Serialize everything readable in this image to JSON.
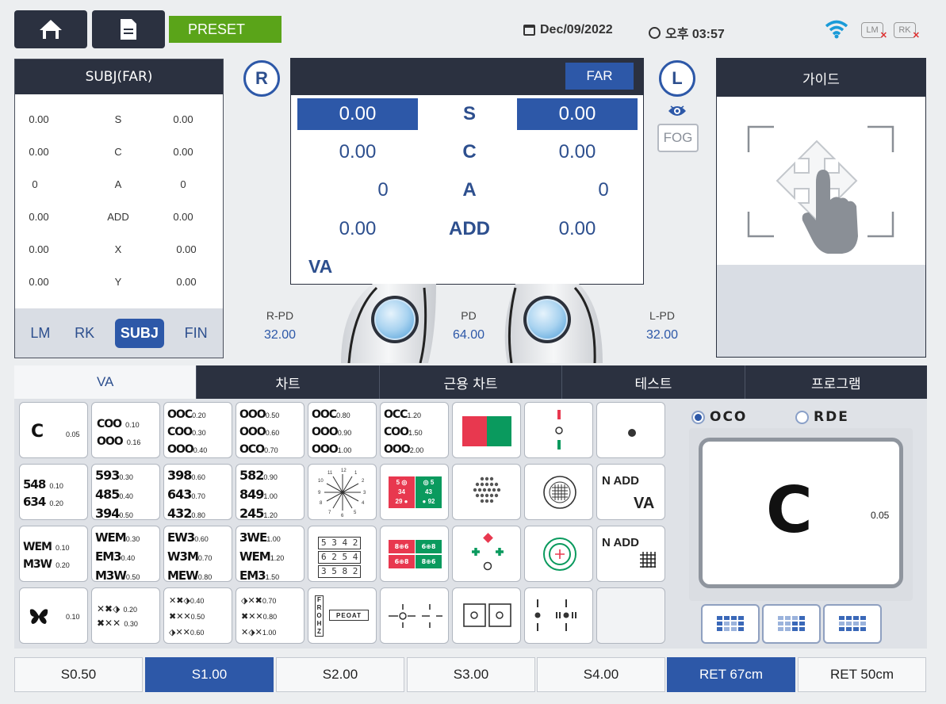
{
  "topbar": {
    "preset_label": "PRESET",
    "date": "Dec/09/2022",
    "time": "오후 03:57",
    "lm_badge": "LM",
    "rk_badge": "RK"
  },
  "subj_panel": {
    "title": "SUBJ(FAR)",
    "rows": [
      {
        "r": "0.00",
        "label": "S",
        "l": "0.00"
      },
      {
        "r": "0.00",
        "label": "C",
        "l": "0.00"
      },
      {
        "r": "0",
        "label": "A",
        "l": "0"
      },
      {
        "r": "0.00",
        "label": "ADD",
        "l": "0.00"
      },
      {
        "r": "0.00",
        "label": "X",
        "l": "0.00"
      },
      {
        "r": "0.00",
        "label": "Y",
        "l": "0.00"
      }
    ],
    "tabs": [
      "LM",
      "RK",
      "SUBJ",
      "FIN"
    ],
    "active_tab": "SUBJ"
  },
  "center": {
    "r_label": "R",
    "l_label": "L",
    "far_label": "FAR",
    "fog_label": "FOG",
    "rows": [
      {
        "r": "0.00",
        "label": "S",
        "l": "0.00",
        "highlight": true
      },
      {
        "r": "0.00",
        "label": "C",
        "l": "0.00",
        "highlight": false
      },
      {
        "r": "0",
        "label": "A",
        "l": "0",
        "highlight": false
      },
      {
        "r": "0.00",
        "label": "ADD",
        "l": "0.00",
        "highlight": false
      }
    ],
    "va_label": "VA"
  },
  "pd": {
    "r_label": "R-PD",
    "r_value": "32.00",
    "c_label": "PD",
    "c_value": "64.00",
    "l_label": "L-PD",
    "l_value": "32.00"
  },
  "guide": {
    "title": "가이드"
  },
  "tabs": [
    "VA",
    "차트",
    "근용 차트",
    "테스트",
    "프로그램"
  ],
  "active_tab": "VA",
  "charts": {
    "c1": {
      "sym": "C",
      "sub": "0.05"
    },
    "c2": [
      {
        "sym": "COO",
        "sub": "0.10"
      },
      {
        "sym": "OOO",
        "sub": "0.16"
      }
    ],
    "c3": [
      {
        "sym": "OOC",
        "sub": "0.20"
      },
      {
        "sym": "COO",
        "sub": "0.30"
      },
      {
        "sym": "OOO",
        "sub": "0.40"
      }
    ],
    "c4": [
      {
        "sym": "OOO",
        "sub": "0.50"
      },
      {
        "sym": "OOO",
        "sub": "0.60"
      },
      {
        "sym": "OCO",
        "sub": "0.70"
      }
    ],
    "c5": [
      {
        "sym": "OOC",
        "sub": "0.80"
      },
      {
        "sym": "OOO",
        "sub": "0.90"
      },
      {
        "sym": "OOO",
        "sub": "1.00"
      }
    ],
    "c6": [
      {
        "sym": "OCC",
        "sub": "1.20"
      },
      {
        "sym": "COO",
        "sub": "1.50"
      },
      {
        "sym": "OOO",
        "sub": "2.00"
      }
    ],
    "n1": [
      {
        "sym": "548",
        "sub": "0.10"
      },
      {
        "sym": "634",
        "sub": "0.20"
      }
    ],
    "n2": [
      {
        "sym": "593",
        "sub": "0.30"
      },
      {
        "sym": "485",
        "sub": "0.40"
      },
      {
        "sym": "394",
        "sub": "0.50"
      }
    ],
    "n3": [
      {
        "sym": "398",
        "sub": "0.60"
      },
      {
        "sym": "643",
        "sub": "0.70"
      },
      {
        "sym": "432",
        "sub": "0.80"
      }
    ],
    "n4": [
      {
        "sym": "582",
        "sub": "0.90"
      },
      {
        "sym": "849",
        "sub": "1.00"
      },
      {
        "sym": "245",
        "sub": "1.20"
      }
    ],
    "w1": [
      {
        "sym": "WEM",
        "sub": "0.10"
      },
      {
        "sym": "M3W",
        "sub": "0.20"
      }
    ],
    "w2": [
      {
        "sym": "WEM",
        "sub": "0.30"
      },
      {
        "sym": "EM3",
        "sub": "0.40"
      },
      {
        "sym": "M3W",
        "sub": "0.50"
      }
    ],
    "w3": [
      {
        "sym": "EW3",
        "sub": "0.60"
      },
      {
        "sym": "W3M",
        "sub": "0.70"
      },
      {
        "sym": "MEW",
        "sub": "0.80"
      }
    ],
    "w4": [
      {
        "sym": "3WE",
        "sub": "1.00"
      },
      {
        "sym": "WEM",
        "sub": "1.20"
      },
      {
        "sym": "EM3",
        "sub": "1.50"
      }
    ],
    "b1": {
      "sub": "0.10"
    },
    "b2": [
      {
        "sub": "0.20"
      },
      {
        "sub": "0.30"
      }
    ],
    "b3": [
      {
        "sub": "0.40"
      },
      {
        "sub": "0.50"
      },
      {
        "sub": "0.60"
      }
    ],
    "b4": [
      {
        "sub": "0.70"
      },
      {
        "sub": "0.80"
      },
      {
        "sub": "1.00"
      }
    ],
    "worth4_nums": {
      "a": "5",
      "b": "5",
      "c": "34",
      "d": "43",
      "e": "29",
      "f": "92"
    },
    "box_nums": [
      "5 3 4 2",
      "6 2 5 4",
      "3 5 8 2"
    ],
    "red_green_tags": [
      "8⊕6",
      "6⊕8",
      "6⊕8",
      "8⊕6"
    ],
    "near_va_label": "N ADD",
    "near_va_sub": "VA",
    "near_grid_label": "N ADD",
    "vertical_letters": "FROHZ",
    "word_label": "PEOAT"
  },
  "right": {
    "radio1": "OCO",
    "radio2": "RDE",
    "preview_sym": "C",
    "preview_sub": "0.05"
  },
  "bottom": [
    "S0.50",
    "S1.00",
    "S2.00",
    "S3.00",
    "S4.00",
    "RET 67cm",
    "RET 50cm"
  ],
  "colors": {
    "accent": "#2d58a8",
    "dark": "#2b3140",
    "preset": "#5aa419",
    "red": "#e8384f",
    "green": "#0a9a5e"
  }
}
